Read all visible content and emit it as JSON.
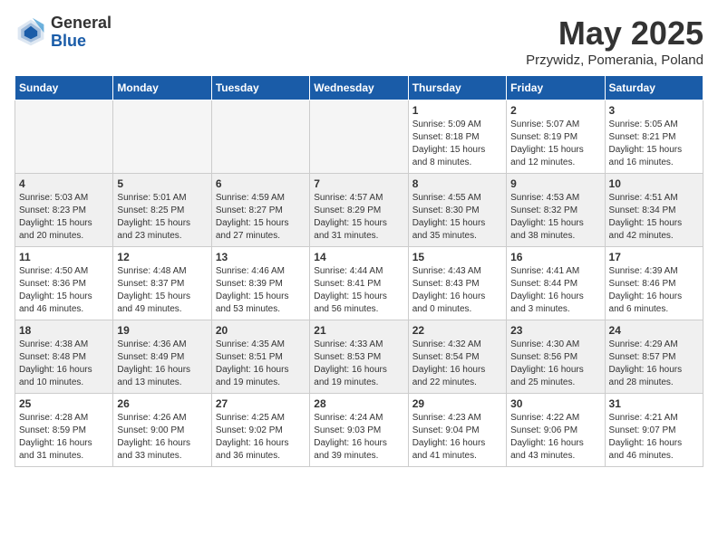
{
  "logo": {
    "general": "General",
    "blue": "Blue"
  },
  "title": "May 2025",
  "location": "Przywidz, Pomerania, Poland",
  "days_header": [
    "Sunday",
    "Monday",
    "Tuesday",
    "Wednesday",
    "Thursday",
    "Friday",
    "Saturday"
  ],
  "weeks": [
    [
      {
        "day": "",
        "info": ""
      },
      {
        "day": "",
        "info": ""
      },
      {
        "day": "",
        "info": ""
      },
      {
        "day": "",
        "info": ""
      },
      {
        "day": "1",
        "info": "Sunrise: 5:09 AM\nSunset: 8:18 PM\nDaylight: 15 hours\nand 8 minutes."
      },
      {
        "day": "2",
        "info": "Sunrise: 5:07 AM\nSunset: 8:19 PM\nDaylight: 15 hours\nand 12 minutes."
      },
      {
        "day": "3",
        "info": "Sunrise: 5:05 AM\nSunset: 8:21 PM\nDaylight: 15 hours\nand 16 minutes."
      }
    ],
    [
      {
        "day": "4",
        "info": "Sunrise: 5:03 AM\nSunset: 8:23 PM\nDaylight: 15 hours\nand 20 minutes."
      },
      {
        "day": "5",
        "info": "Sunrise: 5:01 AM\nSunset: 8:25 PM\nDaylight: 15 hours\nand 23 minutes."
      },
      {
        "day": "6",
        "info": "Sunrise: 4:59 AM\nSunset: 8:27 PM\nDaylight: 15 hours\nand 27 minutes."
      },
      {
        "day": "7",
        "info": "Sunrise: 4:57 AM\nSunset: 8:29 PM\nDaylight: 15 hours\nand 31 minutes."
      },
      {
        "day": "8",
        "info": "Sunrise: 4:55 AM\nSunset: 8:30 PM\nDaylight: 15 hours\nand 35 minutes."
      },
      {
        "day": "9",
        "info": "Sunrise: 4:53 AM\nSunset: 8:32 PM\nDaylight: 15 hours\nand 38 minutes."
      },
      {
        "day": "10",
        "info": "Sunrise: 4:51 AM\nSunset: 8:34 PM\nDaylight: 15 hours\nand 42 minutes."
      }
    ],
    [
      {
        "day": "11",
        "info": "Sunrise: 4:50 AM\nSunset: 8:36 PM\nDaylight: 15 hours\nand 46 minutes."
      },
      {
        "day": "12",
        "info": "Sunrise: 4:48 AM\nSunset: 8:37 PM\nDaylight: 15 hours\nand 49 minutes."
      },
      {
        "day": "13",
        "info": "Sunrise: 4:46 AM\nSunset: 8:39 PM\nDaylight: 15 hours\nand 53 minutes."
      },
      {
        "day": "14",
        "info": "Sunrise: 4:44 AM\nSunset: 8:41 PM\nDaylight: 15 hours\nand 56 minutes."
      },
      {
        "day": "15",
        "info": "Sunrise: 4:43 AM\nSunset: 8:43 PM\nDaylight: 16 hours\nand 0 minutes."
      },
      {
        "day": "16",
        "info": "Sunrise: 4:41 AM\nSunset: 8:44 PM\nDaylight: 16 hours\nand 3 minutes."
      },
      {
        "day": "17",
        "info": "Sunrise: 4:39 AM\nSunset: 8:46 PM\nDaylight: 16 hours\nand 6 minutes."
      }
    ],
    [
      {
        "day": "18",
        "info": "Sunrise: 4:38 AM\nSunset: 8:48 PM\nDaylight: 16 hours\nand 10 minutes."
      },
      {
        "day": "19",
        "info": "Sunrise: 4:36 AM\nSunset: 8:49 PM\nDaylight: 16 hours\nand 13 minutes."
      },
      {
        "day": "20",
        "info": "Sunrise: 4:35 AM\nSunset: 8:51 PM\nDaylight: 16 hours\nand 19 minutes."
      },
      {
        "day": "21",
        "info": "Sunrise: 4:33 AM\nSunset: 8:53 PM\nDaylight: 16 hours\nand 19 minutes."
      },
      {
        "day": "22",
        "info": "Sunrise: 4:32 AM\nSunset: 8:54 PM\nDaylight: 16 hours\nand 22 minutes."
      },
      {
        "day": "23",
        "info": "Sunrise: 4:30 AM\nSunset: 8:56 PM\nDaylight: 16 hours\nand 25 minutes."
      },
      {
        "day": "24",
        "info": "Sunrise: 4:29 AM\nSunset: 8:57 PM\nDaylight: 16 hours\nand 28 minutes."
      }
    ],
    [
      {
        "day": "25",
        "info": "Sunrise: 4:28 AM\nSunset: 8:59 PM\nDaylight: 16 hours\nand 31 minutes."
      },
      {
        "day": "26",
        "info": "Sunrise: 4:26 AM\nSunset: 9:00 PM\nDaylight: 16 hours\nand 33 minutes."
      },
      {
        "day": "27",
        "info": "Sunrise: 4:25 AM\nSunset: 9:02 PM\nDaylight: 16 hours\nand 36 minutes."
      },
      {
        "day": "28",
        "info": "Sunrise: 4:24 AM\nSunset: 9:03 PM\nDaylight: 16 hours\nand 39 minutes."
      },
      {
        "day": "29",
        "info": "Sunrise: 4:23 AM\nSunset: 9:04 PM\nDaylight: 16 hours\nand 41 minutes."
      },
      {
        "day": "30",
        "info": "Sunrise: 4:22 AM\nSunset: 9:06 PM\nDaylight: 16 hours\nand 43 minutes."
      },
      {
        "day": "31",
        "info": "Sunrise: 4:21 AM\nSunset: 9:07 PM\nDaylight: 16 hours\nand 46 minutes."
      }
    ]
  ]
}
